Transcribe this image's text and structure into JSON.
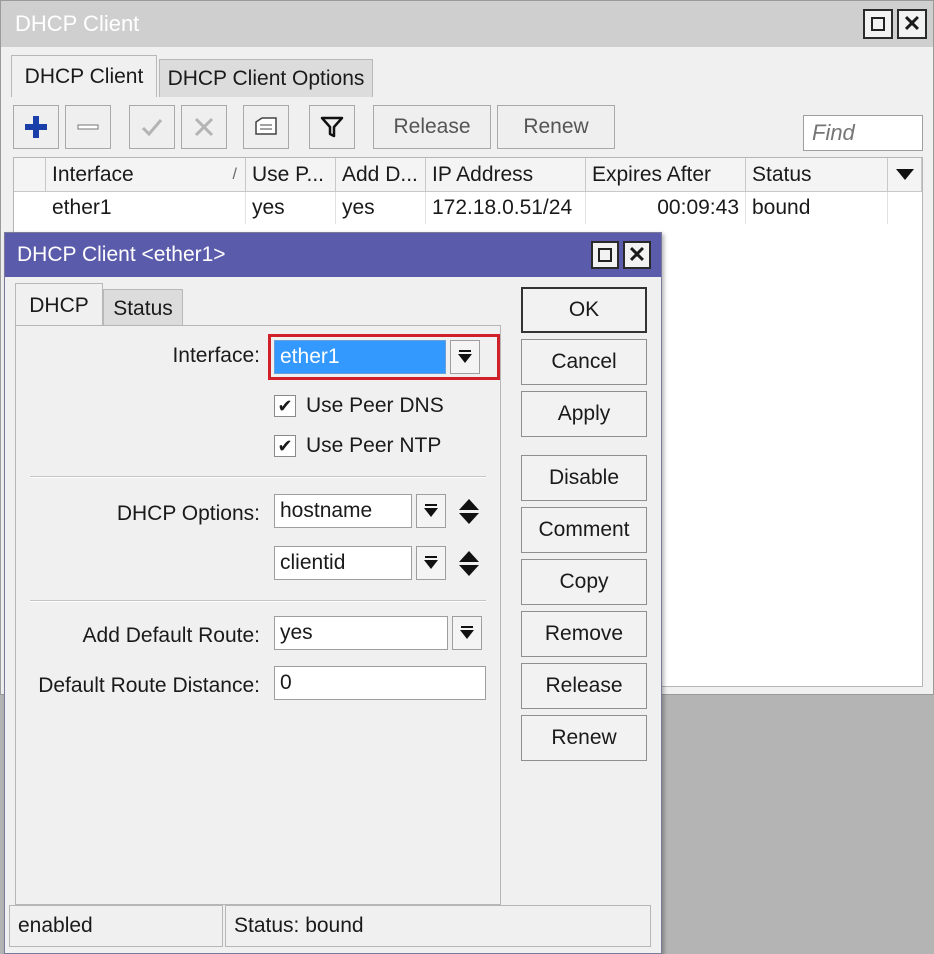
{
  "main_window": {
    "title": "DHCP Client",
    "tabs": [
      {
        "label": "DHCP Client",
        "active": true
      },
      {
        "label": "DHCP Client Options",
        "active": false
      }
    ],
    "toolbar": {
      "add_icon": "plus-icon",
      "remove_icon": "minus-icon",
      "enable_icon": "check-icon",
      "disable_icon": "x-icon",
      "comment_icon": "comment-icon",
      "filter_icon": "filter-icon",
      "release_label": "Release",
      "renew_label": "Renew",
      "find_placeholder": "Find"
    },
    "table": {
      "columns": [
        "Interface",
        "Use P...",
        "Add D...",
        "IP Address",
        "Expires After",
        "Status"
      ],
      "sort_indicator": "/",
      "rows": [
        {
          "interface": "ether1",
          "use_peer": "yes",
          "add_default": "yes",
          "ip_address": "172.18.0.51/24",
          "expires_after": "00:09:43",
          "status": "bound"
        }
      ]
    }
  },
  "dialog": {
    "title": "DHCP Client <ether1>",
    "tabs": [
      {
        "label": "DHCP",
        "active": true
      },
      {
        "label": "Status",
        "active": false
      }
    ],
    "interface_label": "Interface:",
    "interface_value": "ether1",
    "use_peer_dns_label": "Use Peer DNS",
    "use_peer_dns_checked": true,
    "use_peer_ntp_label": "Use Peer NTP",
    "use_peer_ntp_checked": true,
    "dhcp_options_label": "DHCP Options:",
    "dhcp_options": [
      "hostname",
      "clientid"
    ],
    "add_default_route_label": "Add Default Route:",
    "add_default_route_value": "yes",
    "default_route_distance_label": "Default Route Distance:",
    "default_route_distance_value": "0",
    "buttons": [
      "OK",
      "Cancel",
      "Apply",
      "Disable",
      "Comment",
      "Copy",
      "Remove",
      "Release",
      "Renew"
    ],
    "status_bar": {
      "left": "enabled",
      "right": "Status: bound"
    }
  },
  "colors": {
    "active_title": "#5b5bab",
    "inactive_title": "#cfcfcf",
    "highlight_red": "#d0202a",
    "selection_blue": "#3399ff",
    "add_icon_blue": "#1a3fa8"
  }
}
